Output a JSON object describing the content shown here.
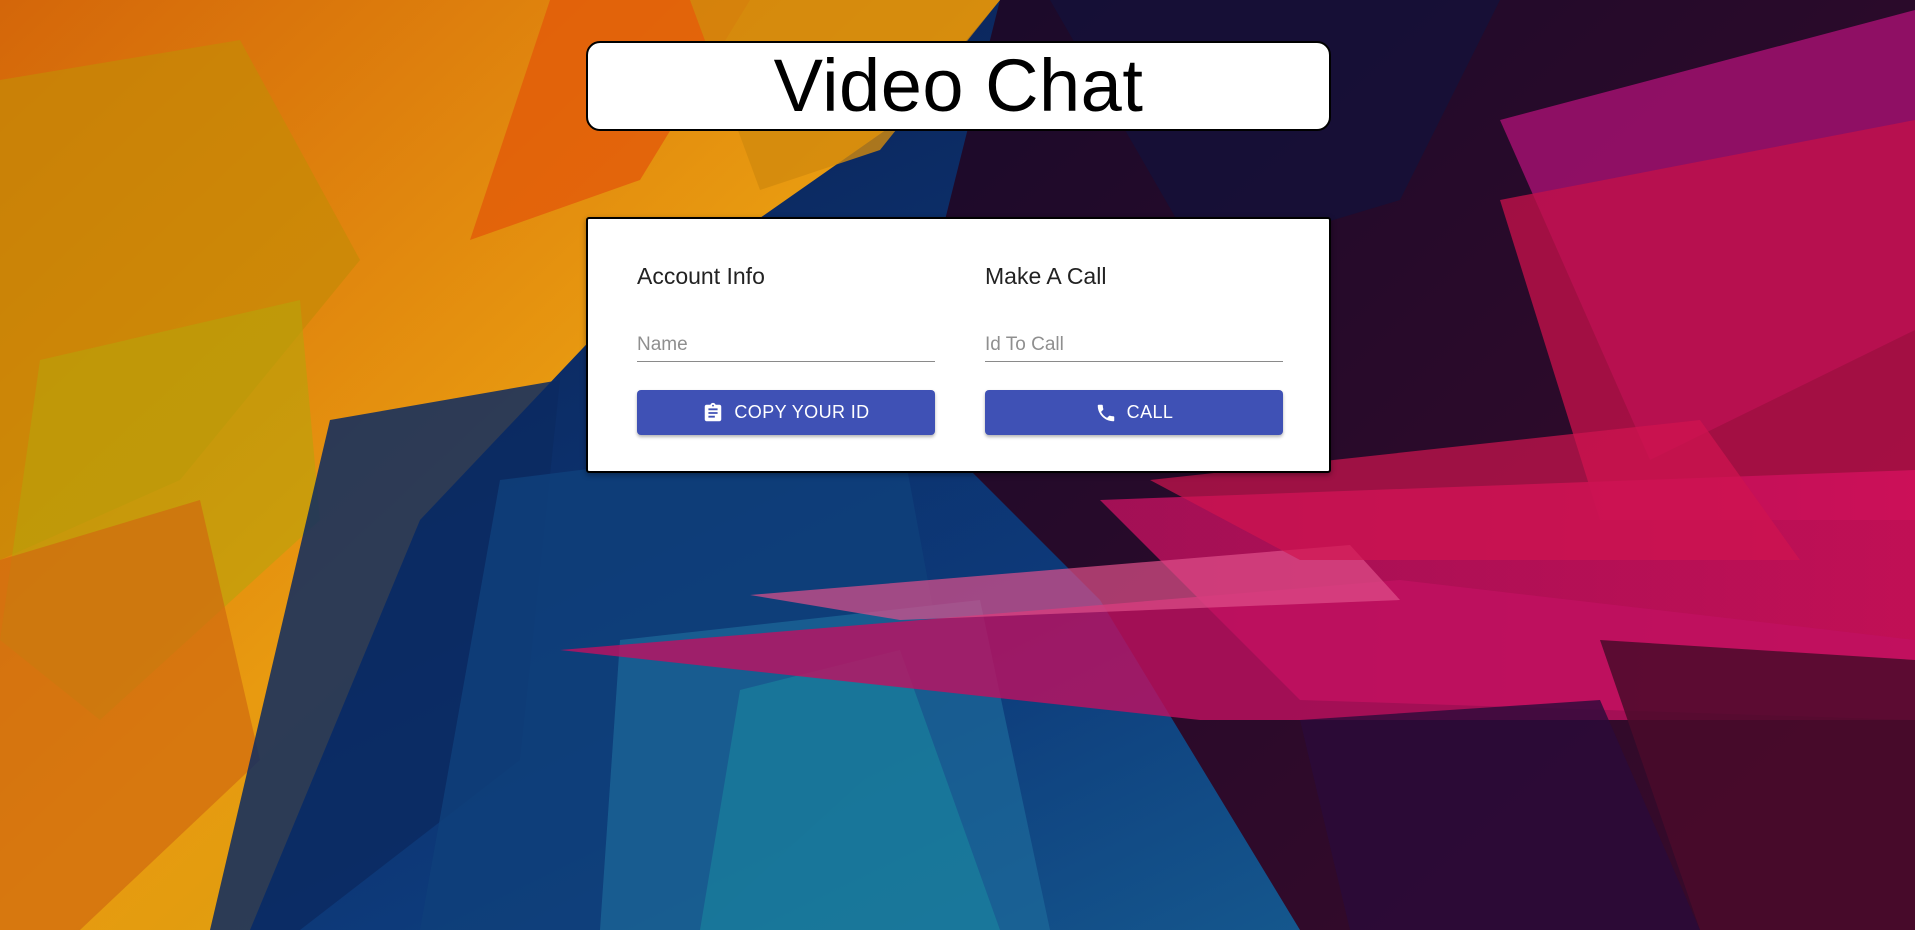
{
  "header": {
    "title": "Video Chat"
  },
  "account": {
    "heading": "Account Info",
    "name_placeholder": "Name",
    "name_value": "",
    "copy_button_label": "COPY YOUR ID",
    "copy_button_icon": "clipboard-icon"
  },
  "call": {
    "heading": "Make A Call",
    "id_placeholder": "Id To Call",
    "id_value": "",
    "call_button_label": "CALL",
    "call_button_icon": "phone-icon"
  },
  "colors": {
    "accent": "#3f51b5",
    "card_background": "#ffffff"
  }
}
